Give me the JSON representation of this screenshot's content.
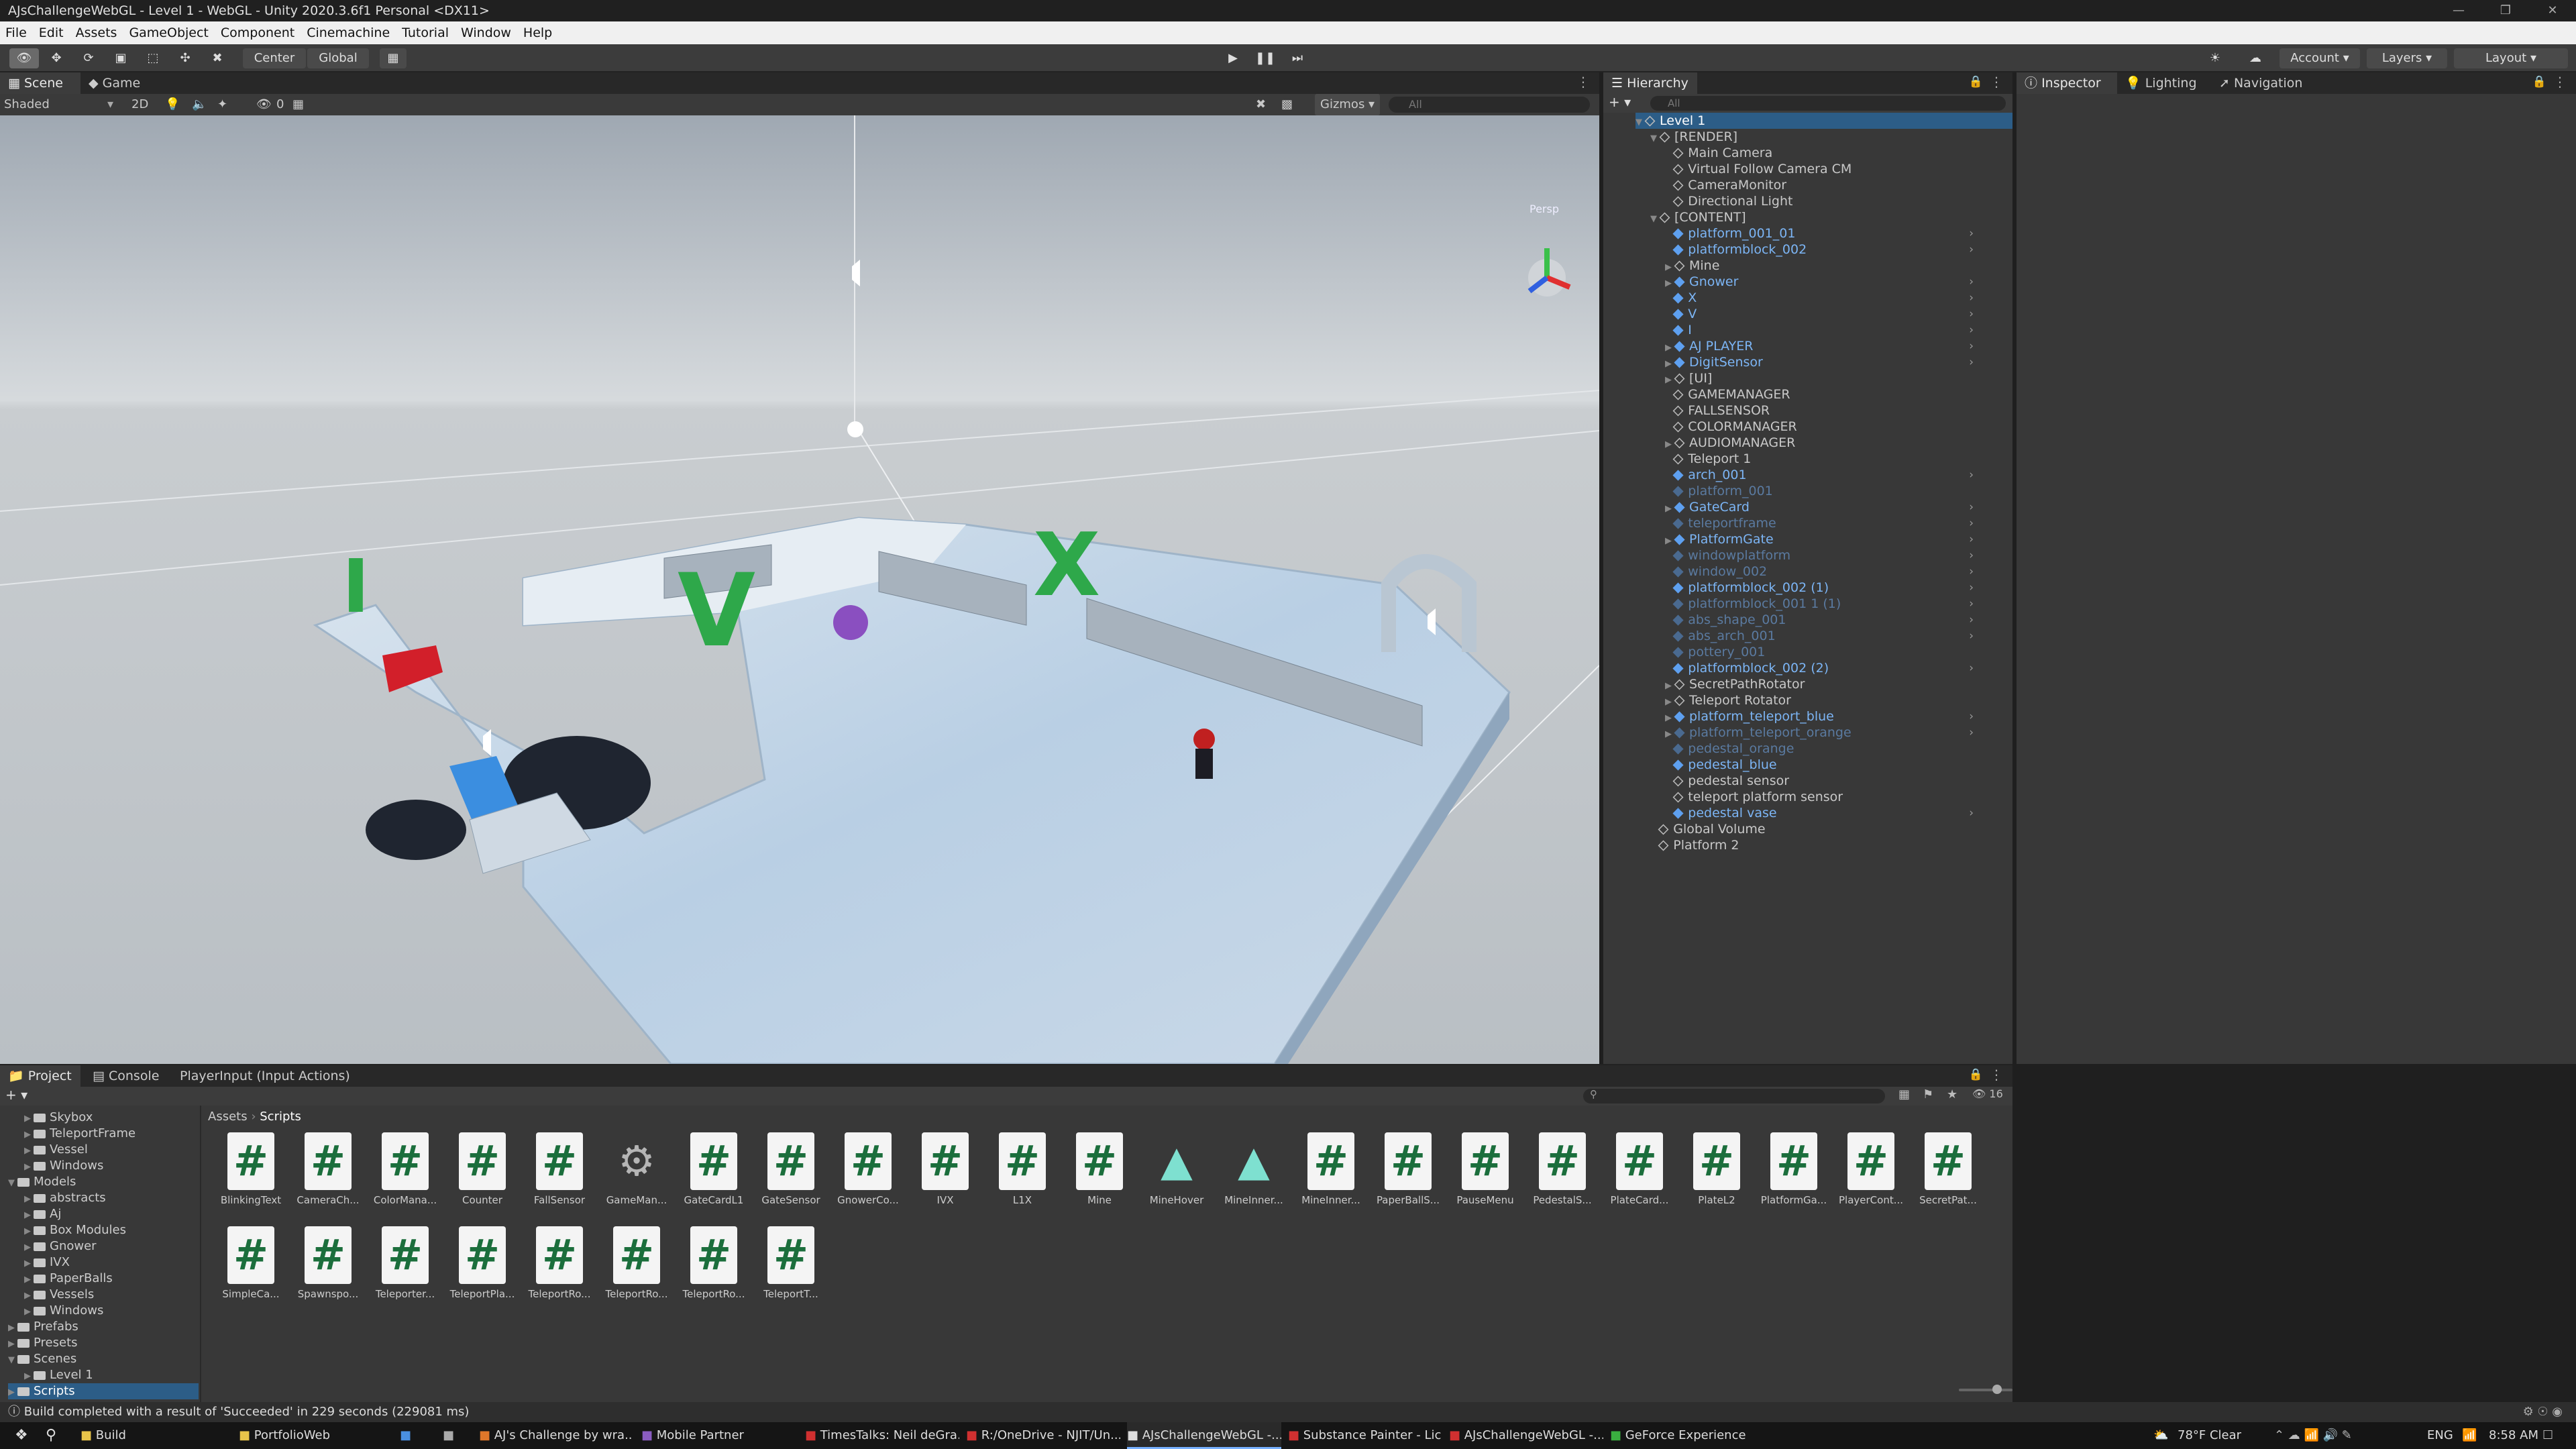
{
  "window": {
    "title": "AJsChallengeWebGL - Level 1 - WebGL - Unity 2020.3.6f1 Personal <DX11>"
  },
  "menu": [
    "File",
    "Edit",
    "Assets",
    "GameObject",
    "Component",
    "Cinemachine",
    "Tutorial",
    "Window",
    "Help"
  ],
  "toolbar": {
    "pivot": "Center",
    "space": "Global",
    "account": "Account",
    "layers": "Layers",
    "layout": "Layout"
  },
  "scene": {
    "tab_scene": "Scene",
    "tab_game": "Game",
    "shading": "Shaded",
    "mode2d": "2D",
    "gizmos": "Gizmos",
    "search_placeholder": "All",
    "hidden_count": "0",
    "persp": "Persp"
  },
  "hierarchy": {
    "title": "Hierarchy",
    "search_placeholder": "All",
    "root": "Level 1",
    "items": [
      {
        "name": "[RENDER]",
        "type": "group",
        "depth": 1,
        "expand": "down"
      },
      {
        "name": "Main Camera",
        "type": "obj",
        "depth": 2
      },
      {
        "name": "Virtual Follow Camera CM",
        "type": "obj",
        "depth": 2
      },
      {
        "name": "CameraMonitor",
        "type": "obj",
        "depth": 2
      },
      {
        "name": "Directional Light",
        "type": "obj",
        "depth": 2
      },
      {
        "name": "[CONTENT]",
        "type": "group",
        "depth": 1,
        "expand": "down"
      },
      {
        "name": "platform_001_01",
        "type": "prefab",
        "depth": 2,
        "chev": true
      },
      {
        "name": "platformblock_002",
        "type": "prefab",
        "depth": 2,
        "chev": true
      },
      {
        "name": "Mine",
        "type": "obj",
        "depth": 2,
        "expand": "right"
      },
      {
        "name": "Gnower",
        "type": "prefab",
        "depth": 2,
        "expand": "right",
        "chev": true
      },
      {
        "name": "X",
        "type": "prefab",
        "depth": 2,
        "chev": true
      },
      {
        "name": "V",
        "type": "prefab",
        "depth": 2,
        "chev": true
      },
      {
        "name": "I",
        "type": "prefab",
        "depth": 2,
        "chev": true
      },
      {
        "name": "AJ PLAYER",
        "type": "prefab",
        "depth": 2,
        "expand": "right",
        "chev": true
      },
      {
        "name": "DigitSensor",
        "type": "prefab",
        "depth": 2,
        "expand": "right",
        "chev": true
      },
      {
        "name": "[UI]",
        "type": "obj",
        "depth": 2,
        "expand": "right"
      },
      {
        "name": "GAMEMANAGER",
        "type": "obj",
        "depth": 2
      },
      {
        "name": "FALLSENSOR",
        "type": "obj",
        "depth": 2
      },
      {
        "name": "COLORMANAGER",
        "type": "obj",
        "depth": 2
      },
      {
        "name": "AUDIOMANAGER",
        "type": "obj",
        "depth": 2,
        "expand": "right"
      },
      {
        "name": "Teleport 1",
        "type": "obj",
        "depth": 2
      },
      {
        "name": "arch_001",
        "type": "prefab",
        "depth": 2,
        "chev": true
      },
      {
        "name": "platform_001",
        "type": "dim",
        "depth": 2
      },
      {
        "name": "GateCard",
        "type": "prefab",
        "depth": 2,
        "expand": "right",
        "chev": true
      },
      {
        "name": "teleportframe",
        "type": "dim",
        "depth": 2,
        "chev": true
      },
      {
        "name": "PlatformGate",
        "type": "prefab",
        "depth": 2,
        "expand": "right",
        "chev": true
      },
      {
        "name": "windowplatform",
        "type": "dim",
        "depth": 2,
        "chev": true
      },
      {
        "name": "window_002",
        "type": "dim",
        "depth": 2,
        "chev": true
      },
      {
        "name": "platformblock_002 (1)",
        "type": "prefab",
        "depth": 2,
        "chev": true
      },
      {
        "name": "platformblock_001 1 (1)",
        "type": "dim",
        "depth": 2,
        "chev": true
      },
      {
        "name": "abs_shape_001",
        "type": "dim",
        "depth": 2,
        "chev": true
      },
      {
        "name": "abs_arch_001",
        "type": "dim",
        "depth": 2,
        "chev": true
      },
      {
        "name": "pottery_001",
        "type": "dim",
        "depth": 2
      },
      {
        "name": "platformblock_002 (2)",
        "type": "prefab",
        "depth": 2,
        "chev": true
      },
      {
        "name": "SecretPathRotator",
        "type": "obj",
        "depth": 2,
        "expand": "right"
      },
      {
        "name": "Teleport Rotator",
        "type": "obj",
        "depth": 2,
        "expand": "right"
      },
      {
        "name": "platform_teleport_blue",
        "type": "prefab",
        "depth": 2,
        "expand": "right",
        "chev": true
      },
      {
        "name": "platform_teleport_orange",
        "type": "dim",
        "depth": 2,
        "expand": "right",
        "chev": true
      },
      {
        "name": "pedestal_orange",
        "type": "dim",
        "depth": 2
      },
      {
        "name": "pedestal_blue",
        "type": "prefab",
        "depth": 2
      },
      {
        "name": "pedestal sensor",
        "type": "obj",
        "depth": 2
      },
      {
        "name": "teleport platform sensor",
        "type": "obj",
        "depth": 2
      },
      {
        "name": "pedestal vase",
        "type": "prefab",
        "depth": 2,
        "chev": true
      },
      {
        "name": "Global Volume",
        "type": "obj",
        "depth": 1
      },
      {
        "name": "Platform 2",
        "type": "obj",
        "depth": 1
      }
    ]
  },
  "inspector": {
    "tab_inspector": "Inspector",
    "tab_lighting": "Lighting",
    "tab_navigation": "Navigation"
  },
  "project": {
    "tab_project": "Project",
    "tab_console": "Console",
    "tab_input": "PlayerInput (Input Actions)",
    "breadcrumb": [
      "Assets",
      "Scripts"
    ],
    "hidden_count": "16",
    "tree": [
      {
        "name": "Skybox",
        "depth": 2
      },
      {
        "name": "TeleportFrame",
        "depth": 2
      },
      {
        "name": "Vessel",
        "depth": 2
      },
      {
        "name": "Windows",
        "depth": 2
      },
      {
        "name": "Models",
        "depth": 1,
        "open": true
      },
      {
        "name": "abstracts",
        "depth": 2
      },
      {
        "name": "Aj",
        "depth": 2
      },
      {
        "name": "Box Modules",
        "depth": 2
      },
      {
        "name": "Gnower",
        "depth": 2
      },
      {
        "name": "IVX",
        "depth": 2
      },
      {
        "name": "PaperBalls",
        "depth": 2
      },
      {
        "name": "Vessels",
        "depth": 2
      },
      {
        "name": "Windows",
        "depth": 2
      },
      {
        "name": "Prefabs",
        "depth": 1
      },
      {
        "name": "Presets",
        "depth": 1
      },
      {
        "name": "Scenes",
        "depth": 1,
        "open": true
      },
      {
        "name": "Level 1",
        "depth": 2
      },
      {
        "name": "Scripts",
        "depth": 1,
        "selected": true
      }
    ],
    "assets": [
      {
        "label": "BlinkingText",
        "kind": "cs"
      },
      {
        "label": "CameraCh...",
        "kind": "cs"
      },
      {
        "label": "ColorMana...",
        "kind": "cs"
      },
      {
        "label": "Counter",
        "kind": "cs"
      },
      {
        "label": "FallSensor",
        "kind": "cs"
      },
      {
        "label": "GameMan...",
        "kind": "gear"
      },
      {
        "label": "GateCardL1",
        "kind": "cs"
      },
      {
        "label": "GateSensor",
        "kind": "cs"
      },
      {
        "label": "GnowerCo...",
        "kind": "cs"
      },
      {
        "label": "IVX",
        "kind": "cs"
      },
      {
        "label": "L1X",
        "kind": "cs"
      },
      {
        "label": "Mine",
        "kind": "cs"
      },
      {
        "label": "MineHover",
        "kind": "shader"
      },
      {
        "label": "MineInner...",
        "kind": "shader"
      },
      {
        "label": "MineInner...",
        "kind": "cs"
      },
      {
        "label": "PaperBallS...",
        "kind": "cs"
      },
      {
        "label": "PauseMenu",
        "kind": "cs"
      },
      {
        "label": "PedestalS...",
        "kind": "cs"
      },
      {
        "label": "PlateCard...",
        "kind": "cs"
      },
      {
        "label": "PlateL2",
        "kind": "cs"
      },
      {
        "label": "PlatformGa...",
        "kind": "cs"
      },
      {
        "label": "PlayerCont...",
        "kind": "cs"
      },
      {
        "label": "SecretPat...",
        "kind": "cs"
      },
      {
        "label": "SimpleCa...",
        "kind": "cs"
      },
      {
        "label": "Spawnspo...",
        "kind": "cs"
      },
      {
        "label": "Teleporter...",
        "kind": "cs"
      },
      {
        "label": "TeleportPla...",
        "kind": "cs"
      },
      {
        "label": "TeleportRo...",
        "kind": "cs"
      },
      {
        "label": "TeleportRo...",
        "kind": "cs"
      },
      {
        "label": "TeleportRo...",
        "kind": "cs"
      },
      {
        "label": "TeleportT...",
        "kind": "cs"
      }
    ]
  },
  "status": {
    "message": "Build completed with a result of 'Succeeded' in 229 seconds (229081 ms)"
  },
  "taskbar": {
    "items": [
      {
        "label": "Build"
      },
      {
        "label": "PortfolioWeb"
      },
      {
        "label": ""
      },
      {
        "label": ""
      },
      {
        "label": "AJ's Challenge by wra..."
      },
      {
        "label": "Mobile Partner"
      },
      {
        "label": "TimesTalks: Neil deGra..."
      },
      {
        "label": "R:/OneDrive - NJIT/Un..."
      },
      {
        "label": "AJsChallengeWebGL -..."
      },
      {
        "label": "Substance Painter - Lic..."
      },
      {
        "label": "AJsChallengeWebGL -..."
      },
      {
        "label": "GeForce Experience"
      }
    ],
    "weather": "78°F  Clear",
    "lang": "ENG",
    "time": "8:58 AM"
  },
  "colors": {
    "accent": "#4a90e2",
    "prefab": "#7cb5f5",
    "green_text": "#1b6e3c"
  }
}
